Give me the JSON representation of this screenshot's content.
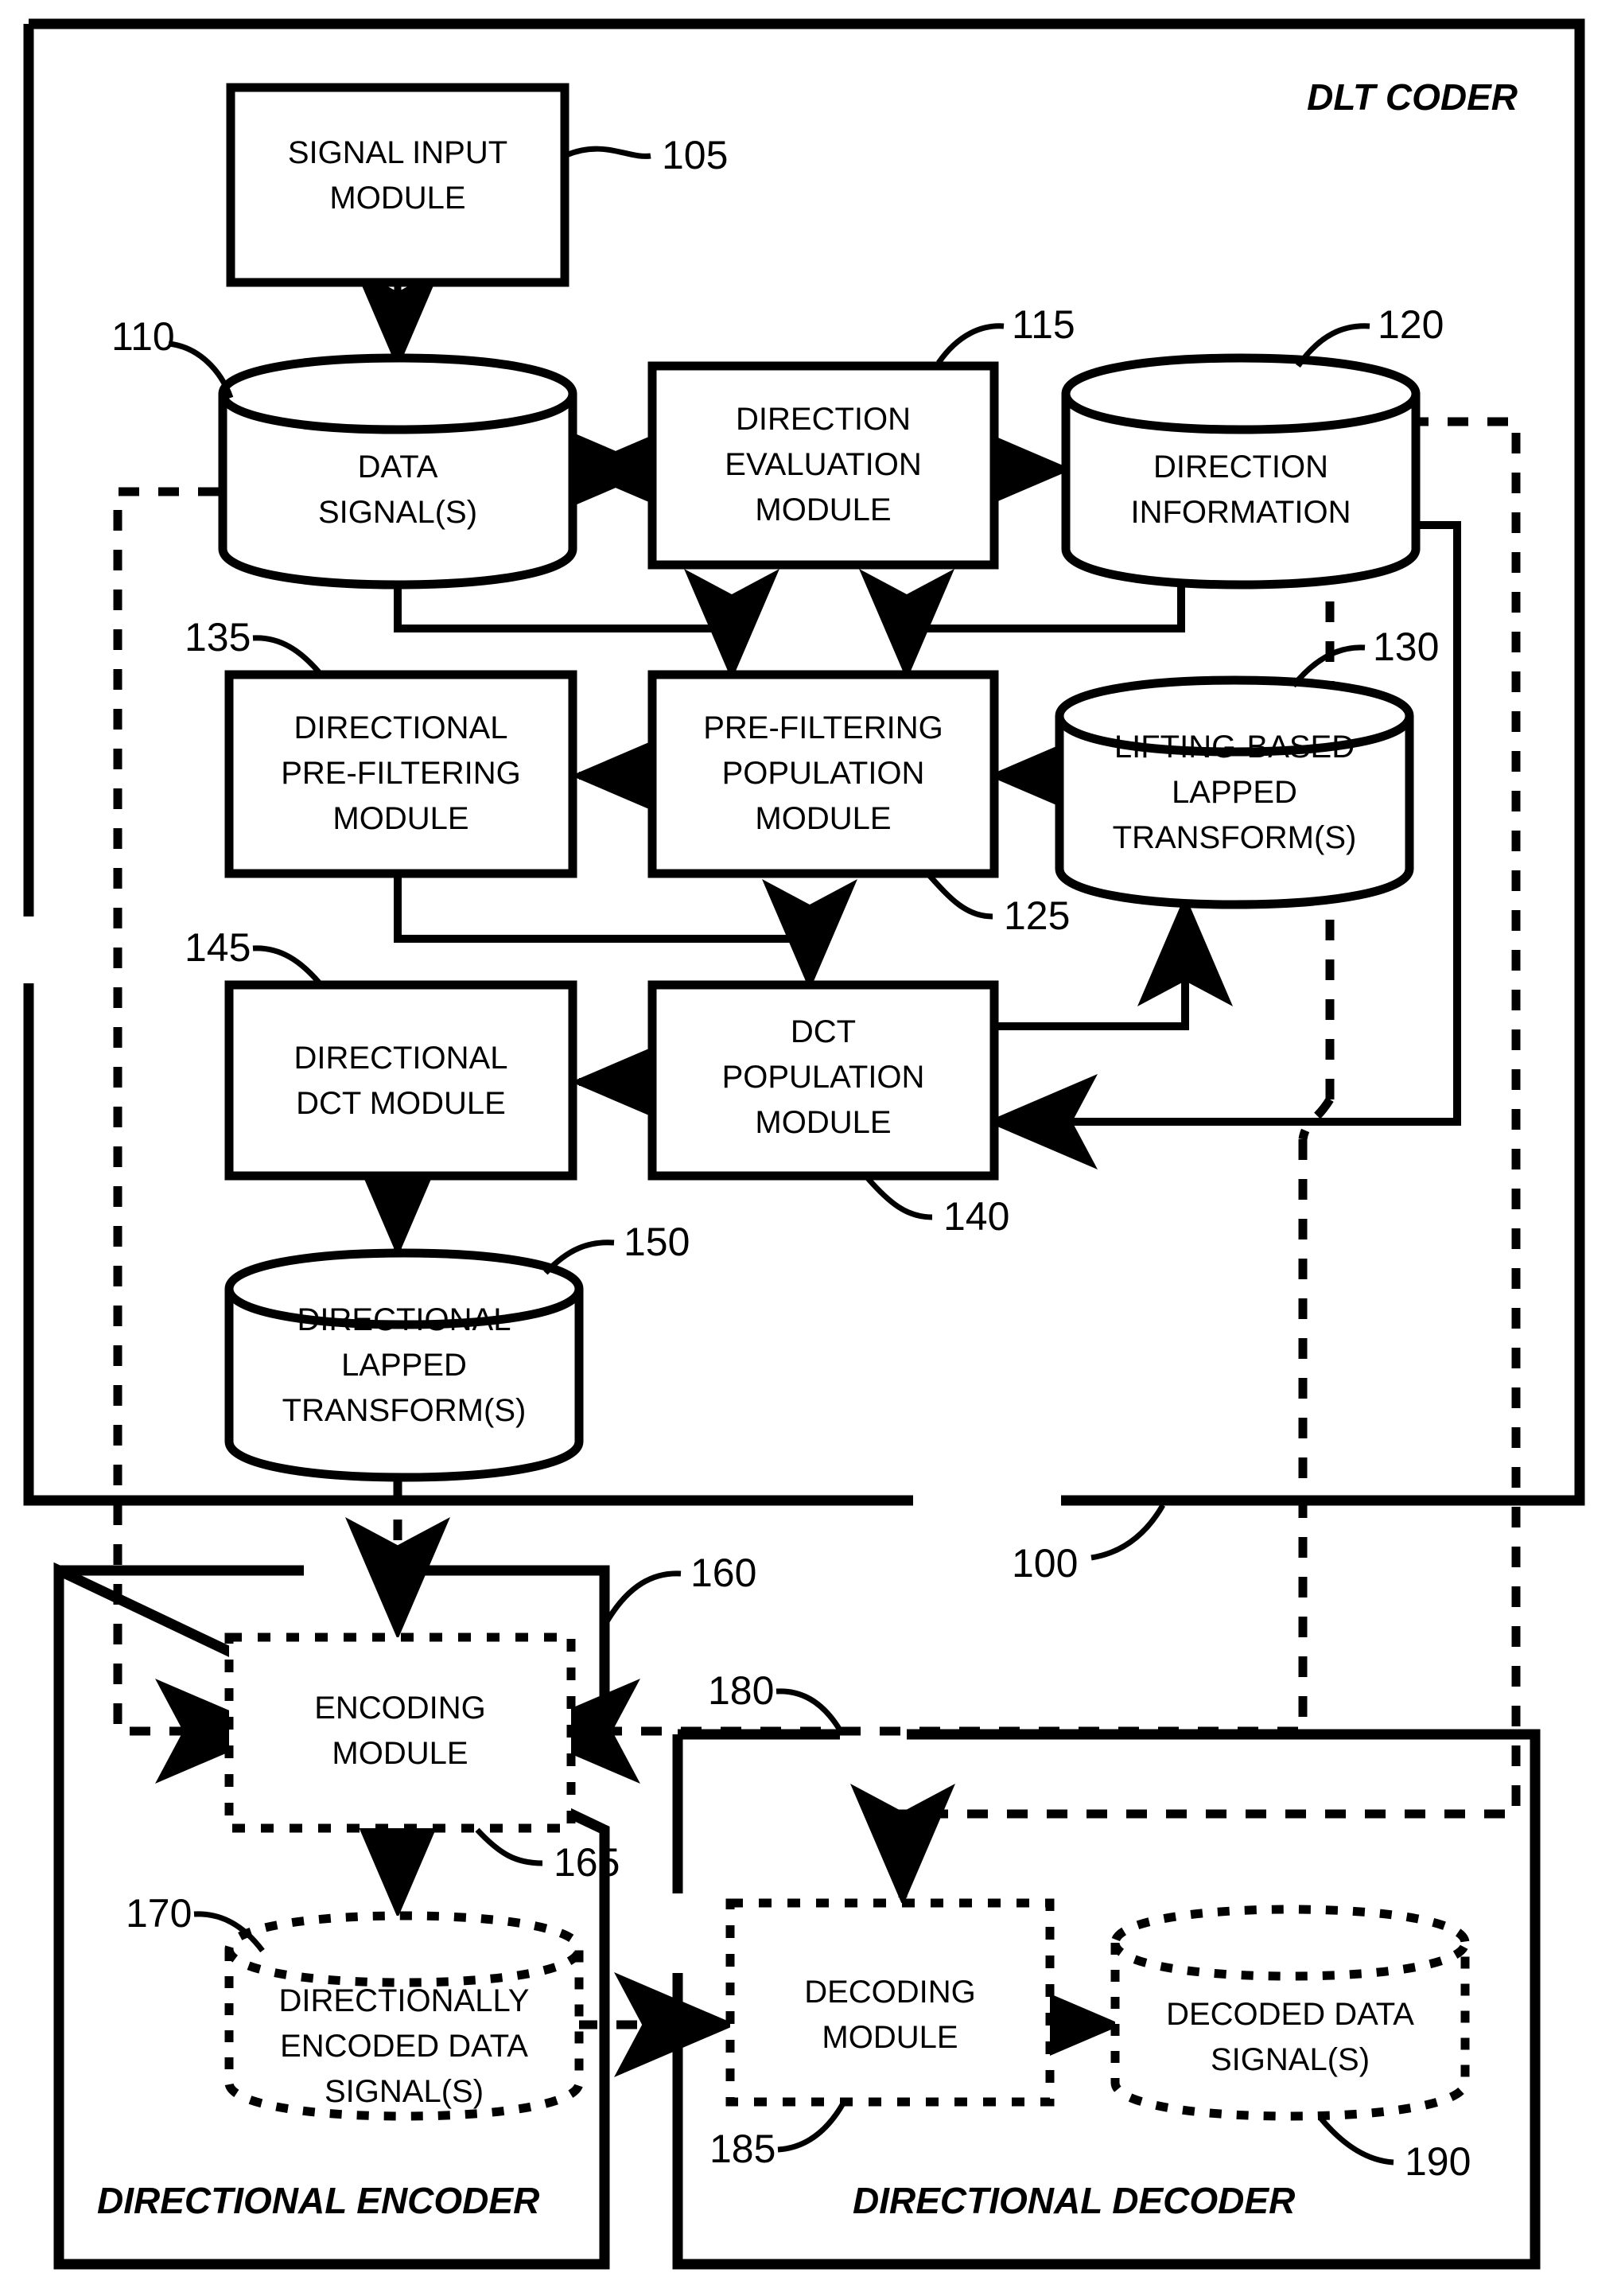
{
  "diagram": {
    "title": "DLT CODER",
    "system_ref": "100",
    "sections": [
      {
        "name": "DLT CODER",
        "ref": "100"
      },
      {
        "name": "DIRECTIONAL ENCODER",
        "ref": "160"
      },
      {
        "name": "DIRECTIONAL DECODER",
        "ref": "180"
      }
    ],
    "nodes": [
      {
        "id": "signal_input",
        "label": "SIGNAL INPUT MODULE",
        "lines": [
          "SIGNAL INPUT",
          "MODULE"
        ],
        "ref": "105",
        "shape": "box",
        "style": "solid"
      },
      {
        "id": "data_signals",
        "label": "DATA SIGNAL(S)",
        "lines": [
          "DATA",
          "SIGNAL(S)"
        ],
        "ref": "110",
        "shape": "cylinder",
        "style": "solid"
      },
      {
        "id": "dir_eval",
        "label": "DIRECTION EVALUATION MODULE",
        "lines": [
          "DIRECTION",
          "EVALUATION",
          "MODULE"
        ],
        "ref": "115",
        "shape": "box",
        "style": "solid"
      },
      {
        "id": "dir_info",
        "label": "DIRECTION INFORMATION",
        "lines": [
          "DIRECTION",
          "INFORMATION"
        ],
        "ref": "120",
        "shape": "cylinder",
        "style": "solid"
      },
      {
        "id": "prefilt_pop",
        "label": "PRE-FILTERING POPULATION MODULE",
        "lines": [
          "PRE-FILTERING",
          "POPULATION",
          "MODULE"
        ],
        "ref": "125",
        "shape": "box",
        "style": "solid"
      },
      {
        "id": "lifting_lapped",
        "label": "LIFTING-BASED LAPPED TRANSFORM(S)",
        "lines": [
          "LIFTING-BASED",
          "LAPPED",
          "TRANSFORM(S)"
        ],
        "ref": "130",
        "shape": "cylinder",
        "style": "solid"
      },
      {
        "id": "dir_prefilt",
        "label": "DIRECTIONAL PRE-FILTERING MODULE",
        "lines": [
          "DIRECTIONAL",
          "PRE-FILTERING",
          "MODULE"
        ],
        "ref": "135",
        "shape": "box",
        "style": "solid"
      },
      {
        "id": "dct_pop",
        "label": "DCT POPULATION MODULE",
        "lines": [
          "DCT",
          "POPULATION",
          "MODULE"
        ],
        "ref": "140",
        "shape": "box",
        "style": "solid"
      },
      {
        "id": "dir_dct",
        "label": "DIRECTIONAL DCT MODULE",
        "lines": [
          "DIRECTIONAL",
          "DCT MODULE"
        ],
        "ref": "145",
        "shape": "box",
        "style": "solid"
      },
      {
        "id": "dir_lapped",
        "label": "DIRECTIONAL LAPPED TRANSFORM(S)",
        "lines": [
          "DIRECTIONAL",
          "LAPPED",
          "TRANSFORM(S)"
        ],
        "ref": "150",
        "shape": "cylinder",
        "style": "solid"
      },
      {
        "id": "encoding",
        "label": "ENCODING MODULE",
        "lines": [
          "ENCODING",
          "MODULE"
        ],
        "ref": "165",
        "shape": "box",
        "style": "dashed"
      },
      {
        "id": "encoded_data",
        "label": "DIRECTIONALLY ENCODED DATA SIGNAL(S)",
        "lines": [
          "DIRECTIONALLY",
          "ENCODED DATA",
          "SIGNAL(S)"
        ],
        "ref": "170",
        "shape": "cylinder",
        "style": "dashed"
      },
      {
        "id": "decoding",
        "label": "DECODING MODULE",
        "lines": [
          "DECODING",
          "MODULE"
        ],
        "ref": "185",
        "shape": "box",
        "style": "dashed"
      },
      {
        "id": "decoded_data",
        "label": "DECODED DATA SIGNAL(S)",
        "lines": [
          "DECODED DATA",
          "SIGNAL(S)"
        ],
        "ref": "190",
        "shape": "cylinder",
        "style": "dashed"
      }
    ],
    "refs": {
      "r100": "100",
      "r105": "105",
      "r110": "110",
      "r115": "115",
      "r120": "120",
      "r125": "125",
      "r130": "130",
      "r135": "135",
      "r140": "140",
      "r145": "145",
      "r150": "150",
      "r160": "160",
      "r165": "165",
      "r170": "170",
      "r180": "180",
      "r185": "185",
      "r190": "190"
    },
    "node_text": {
      "signal_input": {
        "l1": "SIGNAL INPUT",
        "l2": "MODULE"
      },
      "data_signals": {
        "l1": "DATA",
        "l2": "SIGNAL(S)"
      },
      "dir_eval": {
        "l1": "DIRECTION",
        "l2": "EVALUATION",
        "l3": "MODULE"
      },
      "dir_info": {
        "l1": "DIRECTION",
        "l2": "INFORMATION"
      },
      "prefilt_pop": {
        "l1": "PRE-FILTERING",
        "l2": "POPULATION",
        "l3": "MODULE"
      },
      "lifting_lapped": {
        "l1": "LIFTING-BASED",
        "l2": "LAPPED",
        "l3": "TRANSFORM(S)"
      },
      "dir_prefilt": {
        "l1": "DIRECTIONAL",
        "l2": "PRE-FILTERING",
        "l3": "MODULE"
      },
      "dct_pop": {
        "l1": "DCT",
        "l2": "POPULATION",
        "l3": "MODULE"
      },
      "dir_dct": {
        "l1": "DIRECTIONAL",
        "l2": "DCT MODULE"
      },
      "dir_lapped": {
        "l1": "DIRECTIONAL",
        "l2": "LAPPED",
        "l3": "TRANSFORM(S)"
      },
      "encoding": {
        "l1": "ENCODING",
        "l2": "MODULE"
      },
      "encoded_data": {
        "l1": "DIRECTIONALLY",
        "l2": "ENCODED DATA",
        "l3": "SIGNAL(S)"
      },
      "decoding": {
        "l1": "DECODING",
        "l2": "MODULE"
      },
      "decoded_data": {
        "l1": "DECODED DATA",
        "l2": "SIGNAL(S)"
      }
    },
    "section_labels": {
      "coder": "DLT CODER",
      "encoder": "DIRECTIONAL ENCODER",
      "decoder": "DIRECTIONAL DECODER"
    },
    "colors": {
      "ink": "#000000",
      "paper": "#ffffff"
    }
  }
}
